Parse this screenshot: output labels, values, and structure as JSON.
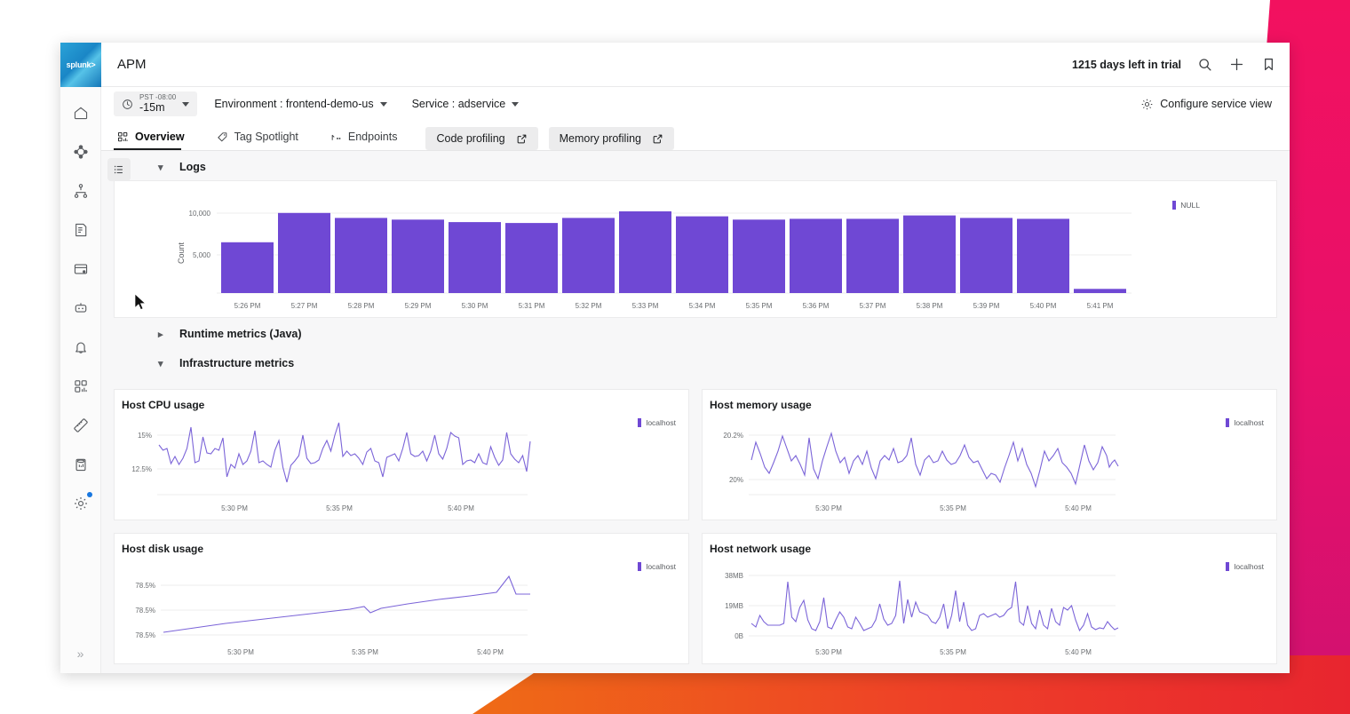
{
  "brand": {
    "logo_text": "splunk>",
    "app_title": "APM",
    "purple": "#6f48d4",
    "accent_blue": "#1877e0"
  },
  "header": {
    "trial_text": "1215 days left in trial",
    "icons": [
      {
        "name": "search-icon",
        "glyph": "search"
      },
      {
        "name": "plus-icon",
        "glyph": "plus"
      },
      {
        "name": "bookmark-icon",
        "glyph": "bookmark"
      }
    ]
  },
  "sidebar": {
    "items": [
      {
        "name": "home",
        "label": "Home"
      },
      {
        "name": "apm",
        "label": "APM"
      },
      {
        "name": "infrastructure",
        "label": "Infrastructure"
      },
      {
        "name": "log-observer",
        "label": "Log Observer"
      },
      {
        "name": "rum",
        "label": "RUM"
      },
      {
        "name": "synthetics",
        "label": "Synthetics"
      },
      {
        "name": "alerts",
        "label": "Alerts"
      },
      {
        "name": "dashboards",
        "label": "Dashboards"
      },
      {
        "name": "metrics",
        "label": "Metrics"
      },
      {
        "name": "data-management",
        "label": "Data Management"
      },
      {
        "name": "settings",
        "label": "Settings",
        "badge": true
      }
    ],
    "collapse_label": "»"
  },
  "filters": {
    "time": {
      "timezone": "PST -08:00",
      "value": "-15m"
    },
    "environment": "Environment : frontend-demo-us",
    "service": "Service : adservice",
    "configure": "Configure service view"
  },
  "tabs": [
    {
      "label": "Overview",
      "icon": "grid-icon",
      "active": true
    },
    {
      "label": "Tag Spotlight",
      "icon": "tag-icon",
      "active": false
    },
    {
      "label": "Endpoints",
      "icon": "endpoints-icon",
      "active": false
    }
  ],
  "profiling_buttons": [
    {
      "label": "Code profiling",
      "icon": "external-link-icon"
    },
    {
      "label": "Memory profiling",
      "icon": "external-link-icon"
    }
  ],
  "sections": [
    {
      "key": "logs",
      "label": "Logs",
      "expanded": true
    },
    {
      "key": "runtime",
      "label": "Runtime metrics (Java)",
      "expanded": false
    },
    {
      "key": "infrastructure",
      "label": "Infrastructure metrics",
      "expanded": true
    }
  ],
  "chart_data": [
    {
      "id": "logs-histogram",
      "type": "bar",
      "title": "Logs",
      "xlabel": "",
      "ylabel": "Count",
      "ylim": [
        0,
        11000
      ],
      "yticks": [
        5000,
        10000
      ],
      "ytick_labels": [
        "5,000",
        "10,000"
      ],
      "grid": true,
      "legend": [
        "NULL"
      ],
      "legend_position": "right",
      "series_color": "#6f48d4",
      "categories": [
        "5:26 PM",
        "5:27 PM",
        "5:28 PM",
        "5:29 PM",
        "5:30 PM",
        "5:31 PM",
        "5:32 PM",
        "5:33 PM",
        "5:34 PM",
        "5:35 PM",
        "5:36 PM",
        "5:37 PM",
        "5:38 PM",
        "5:39 PM",
        "5:40 PM",
        "5:41 PM"
      ],
      "values": [
        6100,
        9600,
        9000,
        8800,
        8500,
        8400,
        9000,
        9800,
        9200,
        8800,
        8900,
        8900,
        9300,
        9000,
        8900,
        500
      ]
    },
    {
      "id": "host-cpu-usage",
      "type": "line",
      "title": "Host CPU usage",
      "xlabel": "",
      "ylabel": "",
      "ylim": [
        11.3,
        16.0
      ],
      "yticks": [
        12.5,
        15
      ],
      "ytick_labels": [
        "12.5%",
        "15%"
      ],
      "xtick_labels": [
        "5:30 PM",
        "5:35 PM",
        "5:40 PM"
      ],
      "grid": true,
      "legend": [
        "localhost"
      ],
      "legend_position": "top-right",
      "series_color": "#7b64d8",
      "values": [
        14.3,
        13.9,
        14.0,
        12.9,
        13.4,
        12.8,
        13.3,
        14.0,
        15.6,
        13.0,
        13.1,
        14.9,
        13.6,
        13.5,
        14.0,
        13.9,
        14.8,
        11.9,
        12.8,
        12.5,
        13.6,
        12.8,
        13.1,
        13.8,
        15.3,
        13.0,
        13.1,
        12.8,
        12.6,
        13.9,
        14.6,
        12.6,
        11.5,
        12.7,
        13.1,
        13.5,
        15.0,
        13.3,
        12.9,
        13.0,
        13.2,
        14.0,
        14.6,
        13.8,
        15.0,
        15.9,
        13.4,
        13.8,
        13.5,
        13.6,
        13.3,
        12.8,
        13.7,
        13.9,
        13.0,
        12.9,
        11.9,
        13.4,
        13.5,
        13.6,
        13.1,
        14.0,
        15.2,
        13.6,
        13.4,
        13.5,
        13.8,
        13.0,
        13.8,
        15.0,
        13.6,
        13.2,
        13.9,
        15.2,
        14.9,
        14.8,
        12.7,
        13.0,
        13.1,
        12.9,
        13.6,
        12.9,
        12.8,
        14.1,
        13.3,
        12.7,
        13.1,
        15.2,
        13.6,
        13.2,
        12.9,
        13.5,
        12.4,
        14.5
      ]
    },
    {
      "id": "host-memory-usage",
      "type": "line",
      "title": "Host memory usage",
      "xlabel": "",
      "ylabel": "",
      "ylim": [
        19.97,
        20.25
      ],
      "yticks": [
        20,
        20.2
      ],
      "ytick_labels": [
        "20%",
        "20.2%"
      ],
      "xtick_labels": [
        "5:30 PM",
        "5:35 PM",
        "5:40 PM"
      ],
      "grid": true,
      "legend": [
        "localhost"
      ],
      "legend_position": "top-right",
      "series_color": "#7b64d8",
      "values": [
        20.1,
        20.17,
        20.12,
        20.06,
        20.04,
        20.08,
        20.13,
        20.2,
        20.14,
        20.09,
        20.11,
        20.07,
        20.03,
        20.19,
        20.05,
        20.02,
        20.09,
        20.15,
        20.21,
        20.13,
        20.08,
        20.1,
        20.04,
        20.09,
        20.11,
        20.07,
        20.13,
        20.06,
        20.02,
        20.09,
        20.12,
        20.1,
        20.14,
        20.08,
        20.09,
        20.11,
        20.19,
        20.07,
        20.03,
        20.1,
        20.12,
        20.08,
        20.09,
        20.13,
        20.1,
        20.07,
        20.08,
        20.12,
        20.16,
        20.11,
        20.08,
        20.09,
        20.05,
        20.02,
        20.04,
        20.03,
        20.01,
        20.06,
        20.12,
        20.17,
        20.09,
        20.15,
        20.07,
        20.04,
        20.0,
        20.05,
        20.13,
        20.09,
        20.11,
        20.14,
        20.08,
        20.06,
        20.04,
        20.01,
        20.07,
        20.16,
        20.09,
        20.05,
        20.08,
        20.15,
        20.11,
        20.06,
        20.08,
        20.1,
        20.07,
        20.06
      ]
    },
    {
      "id": "host-disk-usage",
      "type": "line",
      "title": "Host disk usage",
      "xlabel": "",
      "ylabel": "",
      "ylim": [
        78.49,
        78.56
      ],
      "yticks": [
        78.505,
        78.525,
        78.545
      ],
      "ytick_labels": [
        "78.5%",
        "78.5%",
        "78.5%"
      ],
      "xtick_labels": [
        "5:30 PM",
        "5:35 PM",
        "5:40 PM"
      ],
      "grid": true,
      "legend": [
        "localhost"
      ],
      "legend_position": "top-right",
      "series_color": "#7b64d8",
      "values": [
        78.502,
        78.504,
        78.506,
        78.508,
        78.51,
        78.512,
        78.514,
        78.516,
        78.518,
        78.52,
        78.521,
        78.522,
        78.523,
        78.524,
        78.526,
        78.528,
        78.533,
        78.529,
        78.53,
        78.531,
        78.532,
        78.533,
        78.534,
        78.535,
        78.536,
        78.537,
        78.538,
        78.539,
        78.54,
        78.541,
        78.542,
        78.552,
        78.543,
        78.5425
      ]
    },
    {
      "id": "host-network-usage",
      "type": "line",
      "title": "Host network usage",
      "xlabel": "",
      "ylabel": "",
      "ylim": [
        0,
        40
      ],
      "yticks": [
        0,
        19,
        38
      ],
      "ytick_labels": [
        "0B",
        "19MB",
        "38MB"
      ],
      "xtick_labels": [
        "5:30 PM",
        "5:35 PM",
        "5:40 PM"
      ],
      "grid": true,
      "legend": [
        "localhost"
      ],
      "legend_position": "top-right",
      "series_color": "#7b64d8",
      "values": [
        8,
        6,
        13,
        9,
        7,
        7,
        7,
        7,
        8,
        33,
        12,
        9,
        18,
        22,
        10,
        5,
        4,
        9,
        24,
        6,
        5,
        10,
        15,
        12,
        6,
        5,
        12,
        8,
        4,
        5,
        6,
        10,
        20,
        11,
        7,
        8,
        13,
        34,
        8,
        23,
        12,
        21,
        15,
        14,
        13,
        9,
        8,
        12,
        20,
        5,
        13,
        28,
        10,
        22,
        7,
        4,
        6,
        13,
        14,
        12,
        13,
        11,
        12,
        10,
        13,
        11,
        16,
        18,
        33,
        10,
        6,
        19,
        8,
        5,
        16,
        7,
        5,
        18,
        7,
        6,
        17,
        9,
        7,
        18,
        16,
        19,
        12,
        4
      ]
    }
  ]
}
